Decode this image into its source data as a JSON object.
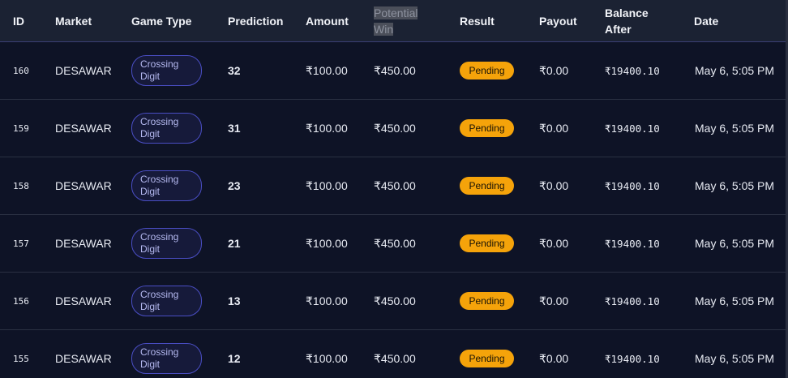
{
  "columns": [
    {
      "key": "id",
      "label": "ID"
    },
    {
      "key": "market",
      "label": "Market"
    },
    {
      "key": "game_type",
      "label": "Game Type"
    },
    {
      "key": "prediction",
      "label": "Prediction"
    },
    {
      "key": "amount",
      "label": "Amount"
    },
    {
      "key": "potential_win",
      "label": "Potential\nWin"
    },
    {
      "key": "result",
      "label": "Result"
    },
    {
      "key": "payout",
      "label": "Payout"
    },
    {
      "key": "balance_after",
      "label": "Balance\nAfter"
    },
    {
      "key": "date",
      "label": "Date"
    }
  ],
  "rows": [
    {
      "id": "160",
      "market": "DESAWAR",
      "game_type": "Crossing\nDigit",
      "prediction": "32",
      "amount": "₹100.00",
      "potential_win": "₹450.00",
      "result": "Pending",
      "payout": "₹0.00",
      "balance_after": "₹19400.10",
      "date": "May 6, 5:05 PM"
    },
    {
      "id": "159",
      "market": "DESAWAR",
      "game_type": "Crossing\nDigit",
      "prediction": "31",
      "amount": "₹100.00",
      "potential_win": "₹450.00",
      "result": "Pending",
      "payout": "₹0.00",
      "balance_after": "₹19400.10",
      "date": "May 6, 5:05 PM"
    },
    {
      "id": "158",
      "market": "DESAWAR",
      "game_type": "Crossing\nDigit",
      "prediction": "23",
      "amount": "₹100.00",
      "potential_win": "₹450.00",
      "result": "Pending",
      "payout": "₹0.00",
      "balance_after": "₹19400.10",
      "date": "May 6, 5:05 PM"
    },
    {
      "id": "157",
      "market": "DESAWAR",
      "game_type": "Crossing\nDigit",
      "prediction": "21",
      "amount": "₹100.00",
      "potential_win": "₹450.00",
      "result": "Pending",
      "payout": "₹0.00",
      "balance_after": "₹19400.10",
      "date": "May 6, 5:05 PM"
    },
    {
      "id": "156",
      "market": "DESAWAR",
      "game_type": "Crossing\nDigit",
      "prediction": "13",
      "amount": "₹100.00",
      "potential_win": "₹450.00",
      "result": "Pending",
      "payout": "₹0.00",
      "balance_after": "₹19400.10",
      "date": "May 6, 5:05 PM"
    },
    {
      "id": "155",
      "market": "DESAWAR",
      "game_type": "Crossing\nDigit",
      "prediction": "12",
      "amount": "₹100.00",
      "potential_win": "₹450.00",
      "result": "Pending",
      "payout": "₹0.00",
      "balance_after": "₹19400.10",
      "date": "May 6, 5:05 PM"
    }
  ],
  "colors": {
    "header_bg": "#1b2233",
    "body_bg": "#0e1326",
    "chip_border": "#4a4ec4",
    "pending_badge": "#f5a30a"
  }
}
